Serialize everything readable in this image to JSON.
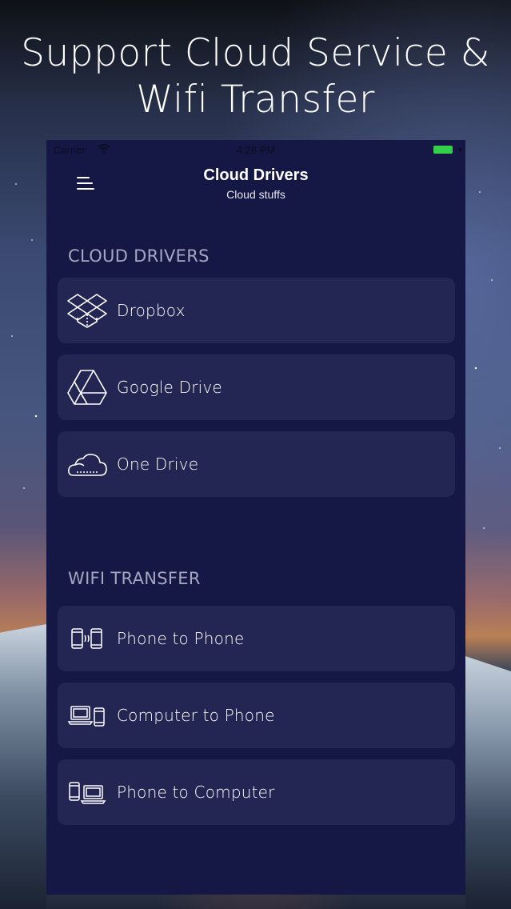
{
  "headline": {
    "line1": "Support Cloud Service &",
    "line2": "Wifi Transfer"
  },
  "status_bar": {
    "carrier": "Carrier",
    "time": "4:28 PM",
    "battery_level_percent": 100,
    "battery_color": "#35d04a"
  },
  "navbar": {
    "menu_icon": "hamburger-menu-icon",
    "title": "Cloud Drivers",
    "subtitle": "Cloud stuffs"
  },
  "cloud_section": {
    "header": "CLOUD DRIVERS",
    "items": [
      {
        "label": "Dropbox",
        "icon": "dropbox-icon"
      },
      {
        "label": "Google Drive",
        "icon": "google-drive-icon"
      },
      {
        "label": "One Drive",
        "icon": "onedrive-icon"
      }
    ]
  },
  "wifi_section": {
    "header": "WIFI TRANSFER",
    "items": [
      {
        "label": "Phone to Phone",
        "icon": "phone-to-phone-icon"
      },
      {
        "label": "Computer to Phone",
        "icon": "computer-to-phone-icon"
      },
      {
        "label": "Phone to Computer",
        "icon": "phone-to-computer-icon"
      }
    ]
  },
  "colors": {
    "panel_background": "#151845",
    "row_background": "#232652",
    "section_header": "#a5a7c2",
    "text": "#ffffff"
  }
}
